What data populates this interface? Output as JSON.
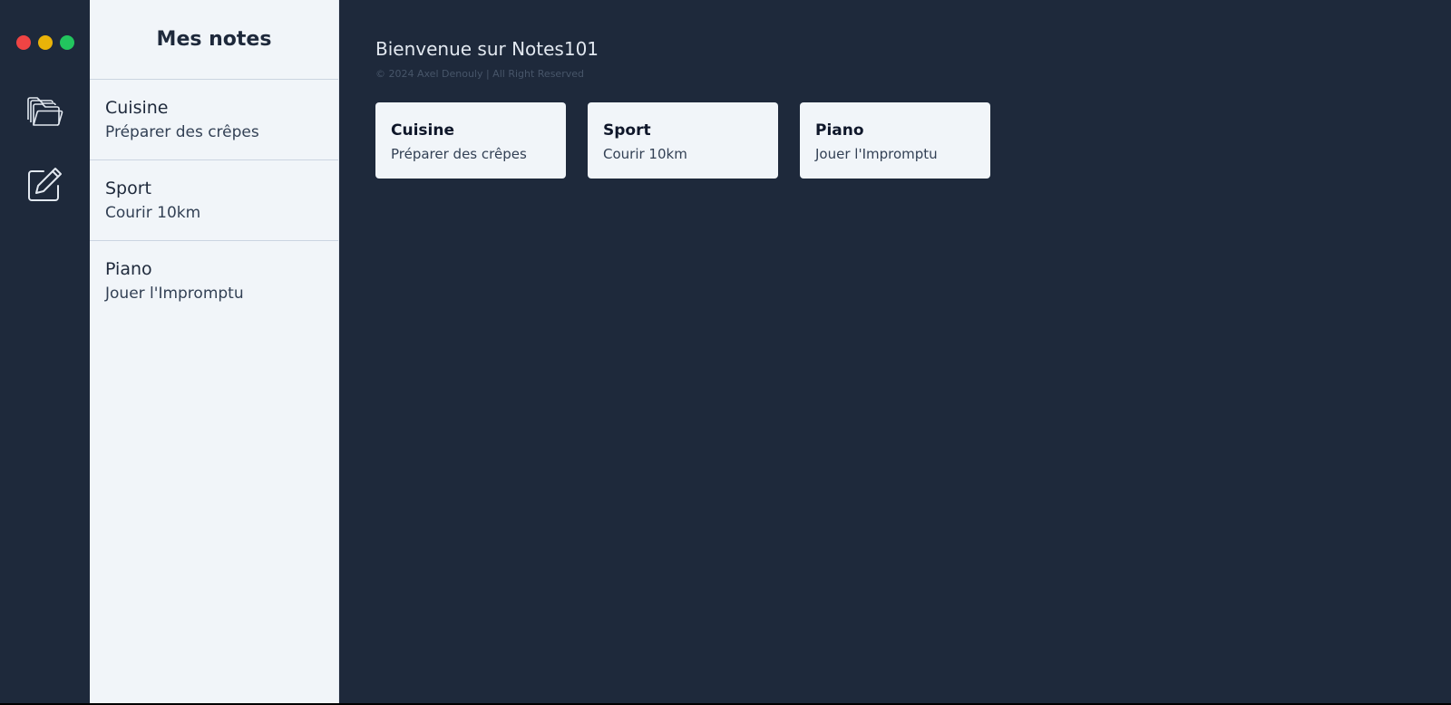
{
  "window": {
    "controls": {
      "close_color": "#ef4444",
      "minimize_color": "#eab308",
      "maximize_color": "#22c55e"
    }
  },
  "rail": {
    "icons": [
      "folders-icon",
      "edit-note-icon"
    ]
  },
  "sidebar": {
    "title": "Mes notes",
    "items": [
      {
        "title": "Cuisine",
        "subtitle": "Préparer des crêpes"
      },
      {
        "title": "Sport",
        "subtitle": "Courir 10km"
      },
      {
        "title": "Piano",
        "subtitle": "Jouer l'Impromptu"
      }
    ]
  },
  "main": {
    "welcome": "Bienvenue sur Notes101",
    "copyright": "© 2024 Axel Denouly | All Right Reserved",
    "cards": [
      {
        "title": "Cuisine",
        "subtitle": "Préparer des crêpes"
      },
      {
        "title": "Sport",
        "subtitle": "Courir 10km"
      },
      {
        "title": "Piano",
        "subtitle": "Jouer l'Impromptu"
      }
    ]
  },
  "colors": {
    "background_dark": "#1e293b",
    "panel_light": "#f1f5f9"
  }
}
